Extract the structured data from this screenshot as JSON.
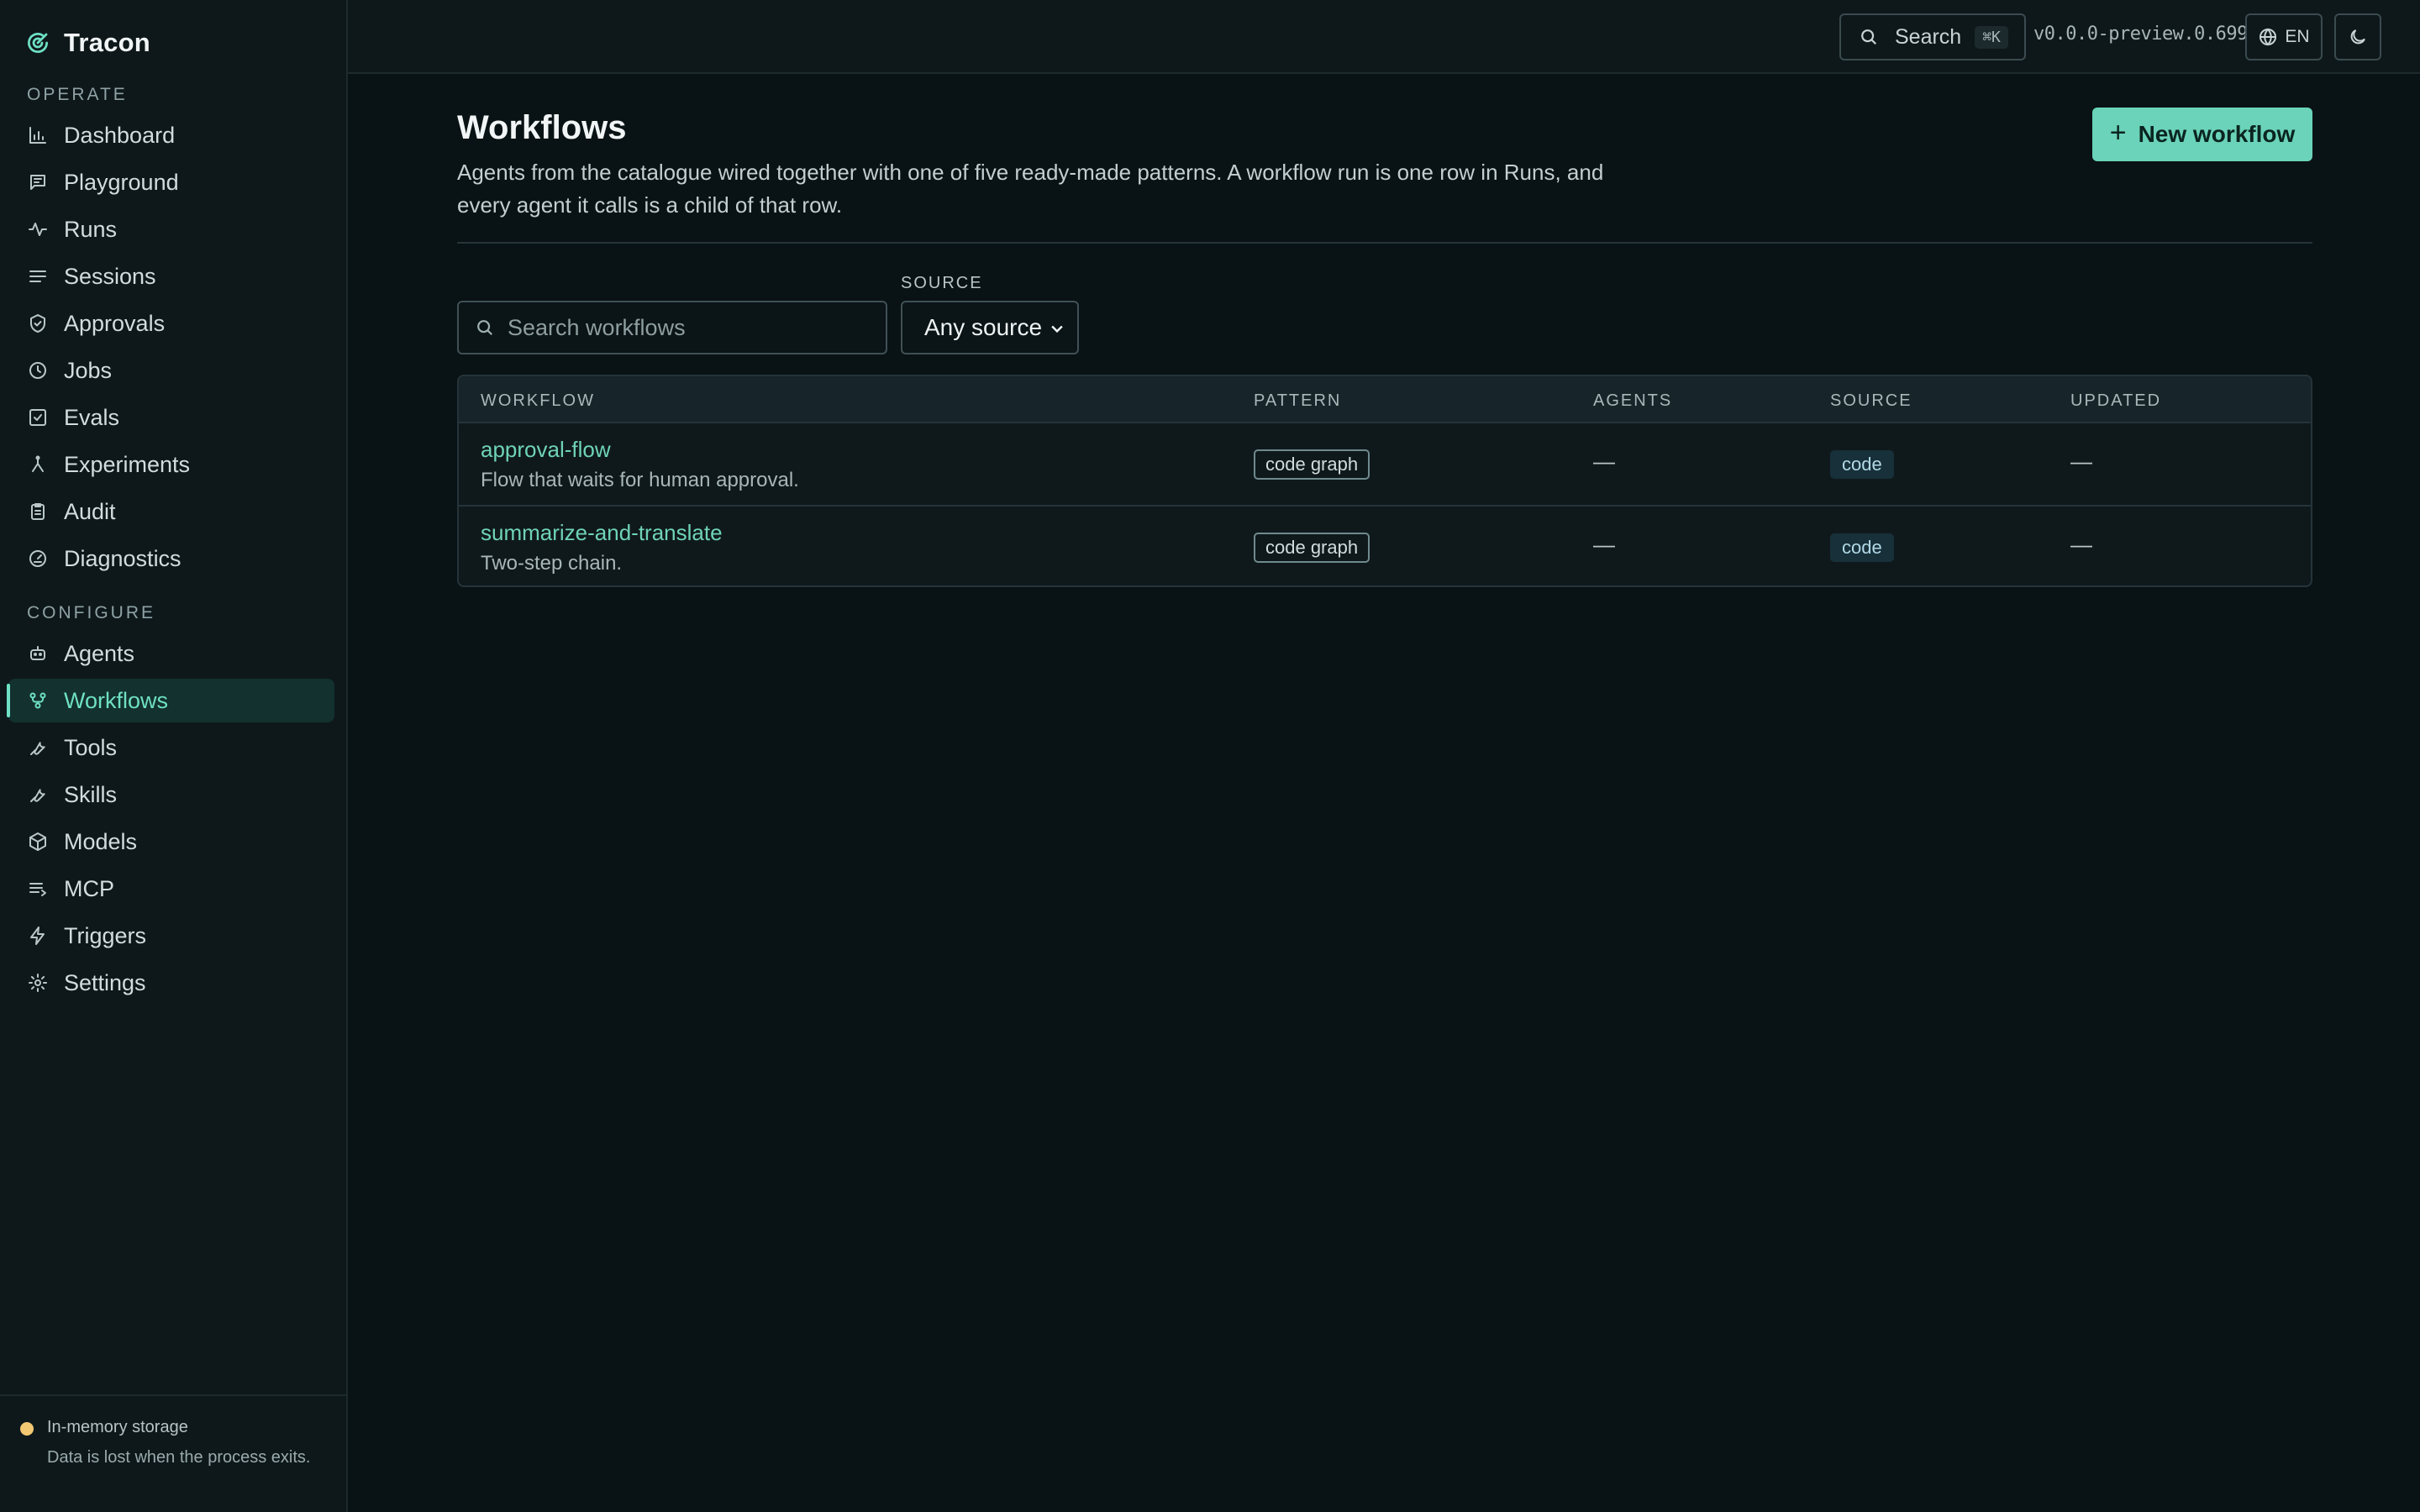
{
  "app": {
    "name": "Tracon"
  },
  "sidebar": {
    "sections": [
      {
        "label": "OPERATE",
        "items": [
          {
            "label": "Dashboard",
            "icon": "bar-chart-icon"
          },
          {
            "label": "Playground",
            "icon": "message-icon"
          },
          {
            "label": "Runs",
            "icon": "activity-icon"
          },
          {
            "label": "Sessions",
            "icon": "list-icon"
          },
          {
            "label": "Approvals",
            "icon": "shield-check-icon"
          },
          {
            "label": "Jobs",
            "icon": "clock-icon"
          },
          {
            "label": "Evals",
            "icon": "checkbox-icon"
          },
          {
            "label": "Experiments",
            "icon": "branch-icon"
          },
          {
            "label": "Audit",
            "icon": "clipboard-icon"
          },
          {
            "label": "Diagnostics",
            "icon": "gauge-icon"
          }
        ]
      },
      {
        "label": "CONFIGURE",
        "items": [
          {
            "label": "Agents",
            "icon": "bot-icon"
          },
          {
            "label": "Workflows",
            "icon": "workflow-icon",
            "active": true
          },
          {
            "label": "Tools",
            "icon": "wrench-icon"
          },
          {
            "label": "Skills",
            "icon": "wrench-icon"
          },
          {
            "label": "Models",
            "icon": "cube-icon"
          },
          {
            "label": "MCP",
            "icon": "server-list-icon"
          },
          {
            "label": "Triggers",
            "icon": "zap-icon"
          },
          {
            "label": "Settings",
            "icon": "settings-icon"
          }
        ]
      }
    ],
    "footer": {
      "title": "In-memory storage",
      "note": "Data is lost when the process exits.",
      "status_color": "#f3c873"
    }
  },
  "topbar": {
    "search_label": "Search",
    "search_shortcut": "⌘K",
    "version": "v0.0.0-preview.0.699",
    "language": "EN"
  },
  "page": {
    "title": "Workflows",
    "description": "Agents from the catalogue wired together with one of five ready-made patterns. A workflow run is one row in Runs, and every agent it calls is a child of that row.",
    "new_button": "New workflow"
  },
  "filters": {
    "search_placeholder": "Search workflows",
    "source_label": "SOURCE",
    "source_value": "Any source"
  },
  "table": {
    "columns": [
      "WORKFLOW",
      "PATTERN",
      "AGENTS",
      "SOURCE",
      "UPDATED"
    ],
    "rows": [
      {
        "name": "approval-flow",
        "description": "Flow that waits for human approval.",
        "pattern": "code graph",
        "agents": "—",
        "source": "code",
        "updated": "—"
      },
      {
        "name": "summarize-and-translate",
        "description": "Two-step chain.",
        "pattern": "code graph",
        "agents": "—",
        "source": "code",
        "updated": "—"
      }
    ]
  },
  "colors": {
    "accent": "#6ee0c5",
    "background": "#091214",
    "sidebar": "#0e181b"
  }
}
